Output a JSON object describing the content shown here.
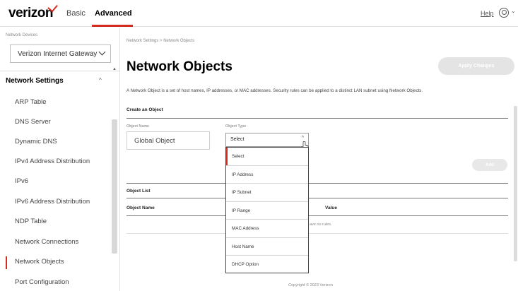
{
  "header": {
    "logo": "verizon",
    "tabs": [
      {
        "label": "Basic"
      },
      {
        "label": "Advanced",
        "active": true
      }
    ],
    "help_label": "Help",
    "user_icon": "user-circle-icon",
    "accent_color": "#d52b1e"
  },
  "sidebar": {
    "devices_label": "Network Devices",
    "device_selected": "Verizon Internet Gateway",
    "section_title": "Network Settings",
    "items": [
      {
        "label": "ARP Table"
      },
      {
        "label": "DNS Server"
      },
      {
        "label": "Dynamic DNS"
      },
      {
        "label": "IPv4 Address Distribution"
      },
      {
        "label": "IPv6"
      },
      {
        "label": "IPv6 Address Distribution"
      },
      {
        "label": "NDP Table"
      },
      {
        "label": "Network Connections"
      },
      {
        "label": "Network Objects",
        "active": true
      },
      {
        "label": "Port Configuration"
      }
    ]
  },
  "main": {
    "breadcrumb": "Network Settings  >  Network Objects",
    "title": "Network Objects",
    "apply_label": "Apply Changes",
    "description": "A Network Object is a set of host names, IP addresses, or MAC addresses. Security rules can be applied to a distinct LAN subnet using Network Objects.",
    "create_heading": "Create an Object",
    "object_name_label": "Object Name",
    "object_name_value": "Global Object",
    "object_type_label": "Object Type",
    "object_type_value": "Select",
    "add_label": "Add",
    "list_heading": "Object List",
    "columns": [
      "Object Name",
      "Value"
    ],
    "empty_text": "ave no rules.",
    "dropdown_options": [
      {
        "label": "Select",
        "selected": true
      },
      {
        "label": "IP Address"
      },
      {
        "label": "IP Subnet"
      },
      {
        "label": "IP Range"
      },
      {
        "label": "MAC Address"
      },
      {
        "label": "Host Name"
      },
      {
        "label": "DHCP Option"
      }
    ]
  },
  "footer": {
    "copyright": "Copyright © 2023 Verizon"
  }
}
